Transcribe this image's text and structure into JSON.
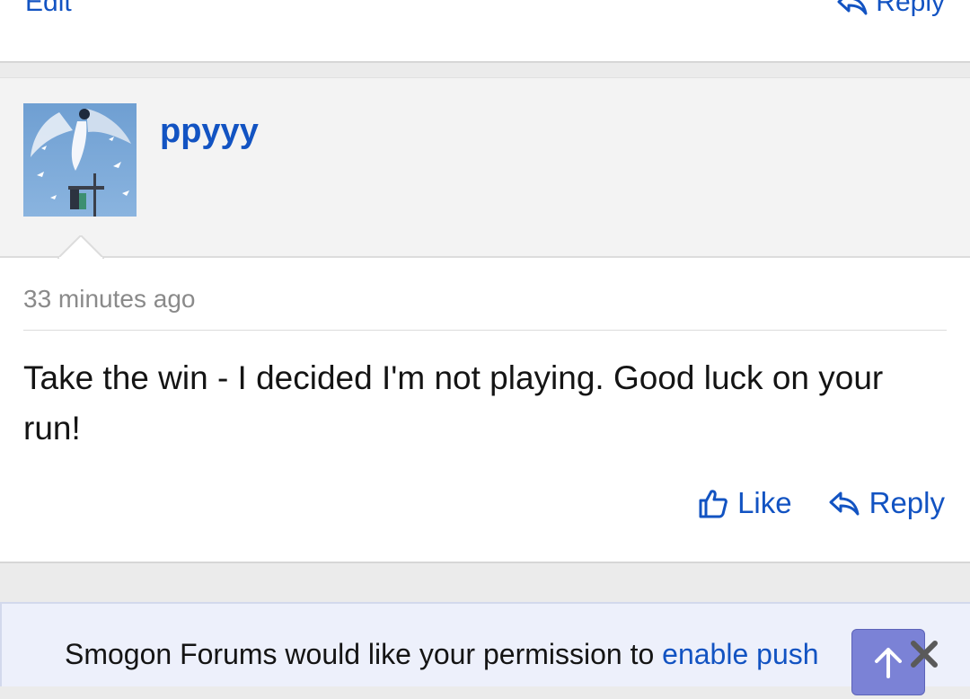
{
  "prev_post": {
    "edit_label": "Edit",
    "reply_label": "Reply"
  },
  "post": {
    "username": "ppyyy",
    "timestamp": "33 minutes ago",
    "body": "Take the win - I decided I'm not playing. Good luck on your run!",
    "like_label": "Like",
    "reply_label": "Reply"
  },
  "push_banner": {
    "text": "Smogon Forums would like your permission to ",
    "link_text": "enable push"
  },
  "colors": {
    "link": "#1253c2",
    "scroll_button": "#7b82d6"
  },
  "icons": [
    "reply-icon",
    "like-icon",
    "arrow-up-icon",
    "close-icon"
  ]
}
